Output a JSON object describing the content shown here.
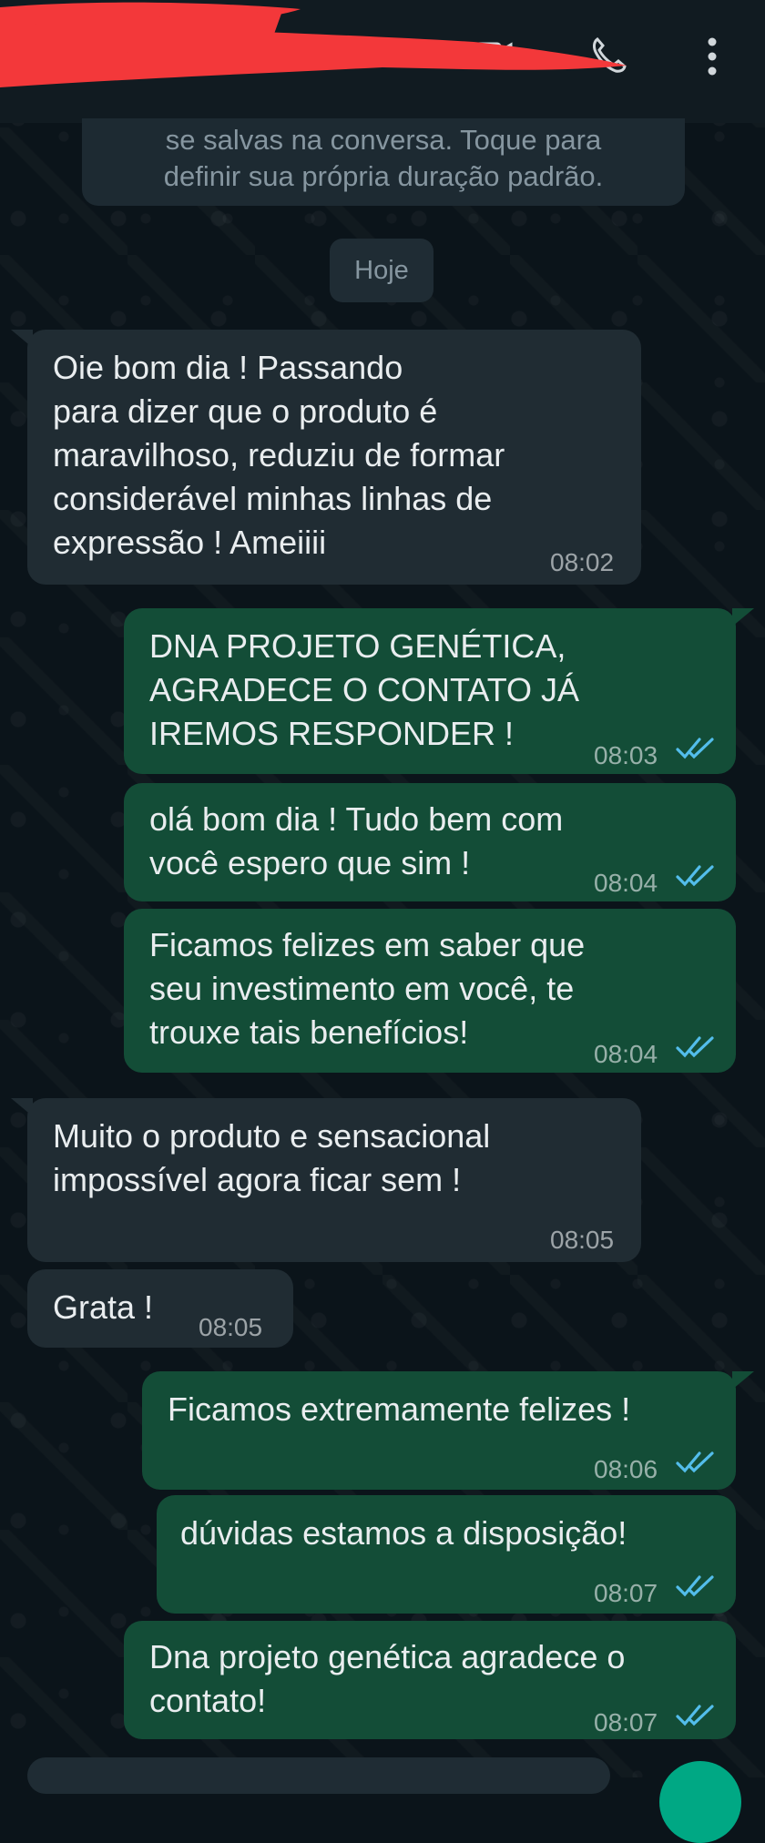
{
  "header": {
    "icons": [
      "video-call-icon",
      "phone-icon",
      "more-vert-icon"
    ]
  },
  "system_message": {
    "line1": "se salvas na conversa. Toque para",
    "line2": "definir sua própria duração padrão."
  },
  "date_label": "Hoje",
  "messages": [
    {
      "dir": "in",
      "lines": [
        "Oie bom dia ! Passando",
        "para dizer que o produto é",
        "maravilhoso, reduziu de formar",
        "considerável minhas linhas de",
        "expressão ! Ameiiii"
      ],
      "time": "08:02"
    },
    {
      "dir": "out",
      "lines": [
        "DNA PROJETO GENÉTICA,",
        "AGRADECE O CONTATO JÁ",
        "IREMOS RESPONDER !"
      ],
      "time": "08:03"
    },
    {
      "dir": "out",
      "lines": [
        "olá bom dia ! Tudo bem com",
        "você espero que sim !"
      ],
      "time": "08:04"
    },
    {
      "dir": "out",
      "lines": [
        "Ficamos felizes em saber que",
        "seu investimento em você, te",
        "trouxe tais benefícios!"
      ],
      "time": "08:04"
    },
    {
      "dir": "in",
      "lines": [
        "Muito o produto e sensacional",
        "impossível agora ficar sem !"
      ],
      "time": "08:05"
    },
    {
      "dir": "in",
      "lines": [
        "Grata !"
      ],
      "time": "08:05"
    },
    {
      "dir": "out",
      "lines": [
        "Ficamos extremamente felizes !"
      ],
      "time": "08:06"
    },
    {
      "dir": "out",
      "lines": [
        "dúvidas estamos a disposição!"
      ],
      "time": "08:07"
    },
    {
      "dir": "out",
      "lines": [
        "Dna projeto genética agradece o",
        "contato!"
      ],
      "time": "08:07"
    }
  ],
  "colors": {
    "background": "#0b141a",
    "incoming_bubble": "#202c33",
    "outgoing_bubble": "#134d37",
    "read_ticks": "#53bdeb",
    "redaction": "#f3383a"
  }
}
